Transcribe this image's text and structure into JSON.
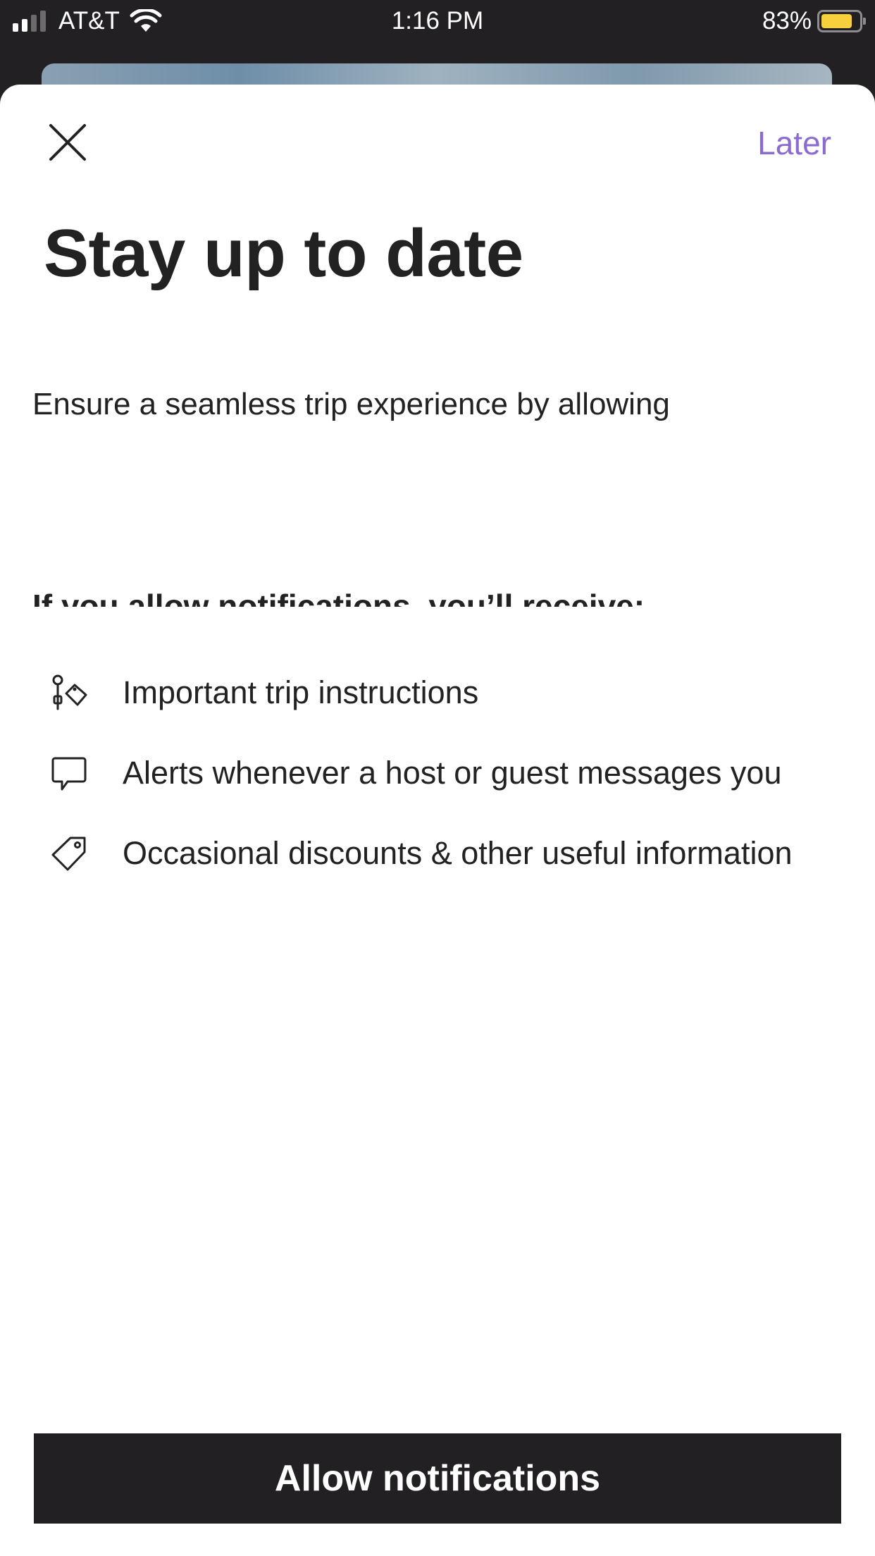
{
  "status_bar": {
    "carrier": "AT&T",
    "time": "1:16 PM",
    "battery_percent": "83%",
    "signal_bars_active": 2,
    "signal_bars_total": 4,
    "battery_level": 0.83,
    "battery_color": "#f6d03d"
  },
  "header": {
    "close_icon": "close-icon",
    "later_label": "Later"
  },
  "main": {
    "title": "Stay up to date",
    "intro": "Ensure a seamless trip experience by allowing",
    "section_heading": "If you allow notifications, you’ll receive:",
    "benefits": [
      {
        "icon": "key-tag-icon",
        "text": "Important trip instructions"
      },
      {
        "icon": "chat-bubble-icon",
        "text": "Alerts whenever a host or guest messages you"
      },
      {
        "icon": "price-tag-icon",
        "text": "Occasional discounts & other useful information"
      }
    ]
  },
  "footer": {
    "primary_button_label": "Allow notifications"
  },
  "colors": {
    "accent": "#8a6bd1",
    "primary_button": "#222023",
    "text": "#222222"
  }
}
